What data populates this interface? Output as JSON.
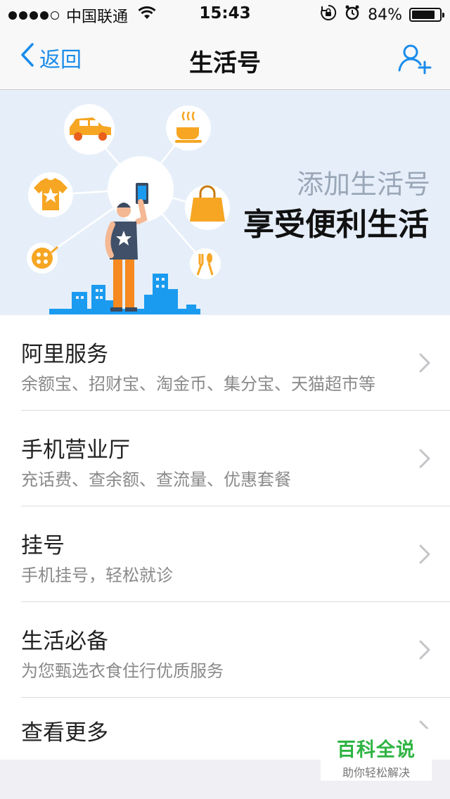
{
  "status_bar": {
    "carrier": "中国联通",
    "time": "15:43",
    "battery": "84%",
    "battery_level": 0.84,
    "icons": [
      "signal-dots-icon",
      "wifi-icon",
      "rotation-lock-icon",
      "alarm-icon",
      "battery-icon"
    ]
  },
  "nav": {
    "back_label": "返回",
    "title": "生活号",
    "right_icon": "add-user-icon",
    "accent_color": "#1a8ceb"
  },
  "banner": {
    "subtitle": "添加生活号",
    "headline": "享受便利生活",
    "background_color": "#e6eff9",
    "illustration_icons": [
      "car-icon",
      "coffee-cup-icon",
      "tshirt-icon",
      "phone-icon",
      "shopping-bag-icon",
      "film-reel-icon",
      "fork-spoon-icon",
      "city-skyline"
    ]
  },
  "list": {
    "items": [
      {
        "title": "阿里服务",
        "desc": "余额宝、招财宝、淘金币、集分宝、天猫超市等"
      },
      {
        "title": "手机营业厅",
        "desc": "充话费、查余额、查流量、优惠套餐"
      },
      {
        "title": "挂号",
        "desc": "手机挂号，轻松就诊"
      },
      {
        "title": "生活必备",
        "desc": "为您甄选衣食住行优质服务"
      },
      {
        "title": "查看更多"
      }
    ]
  },
  "watermark": {
    "title": "百科全说",
    "subtitle": "助你轻松解决",
    "color": "#2fb443"
  }
}
